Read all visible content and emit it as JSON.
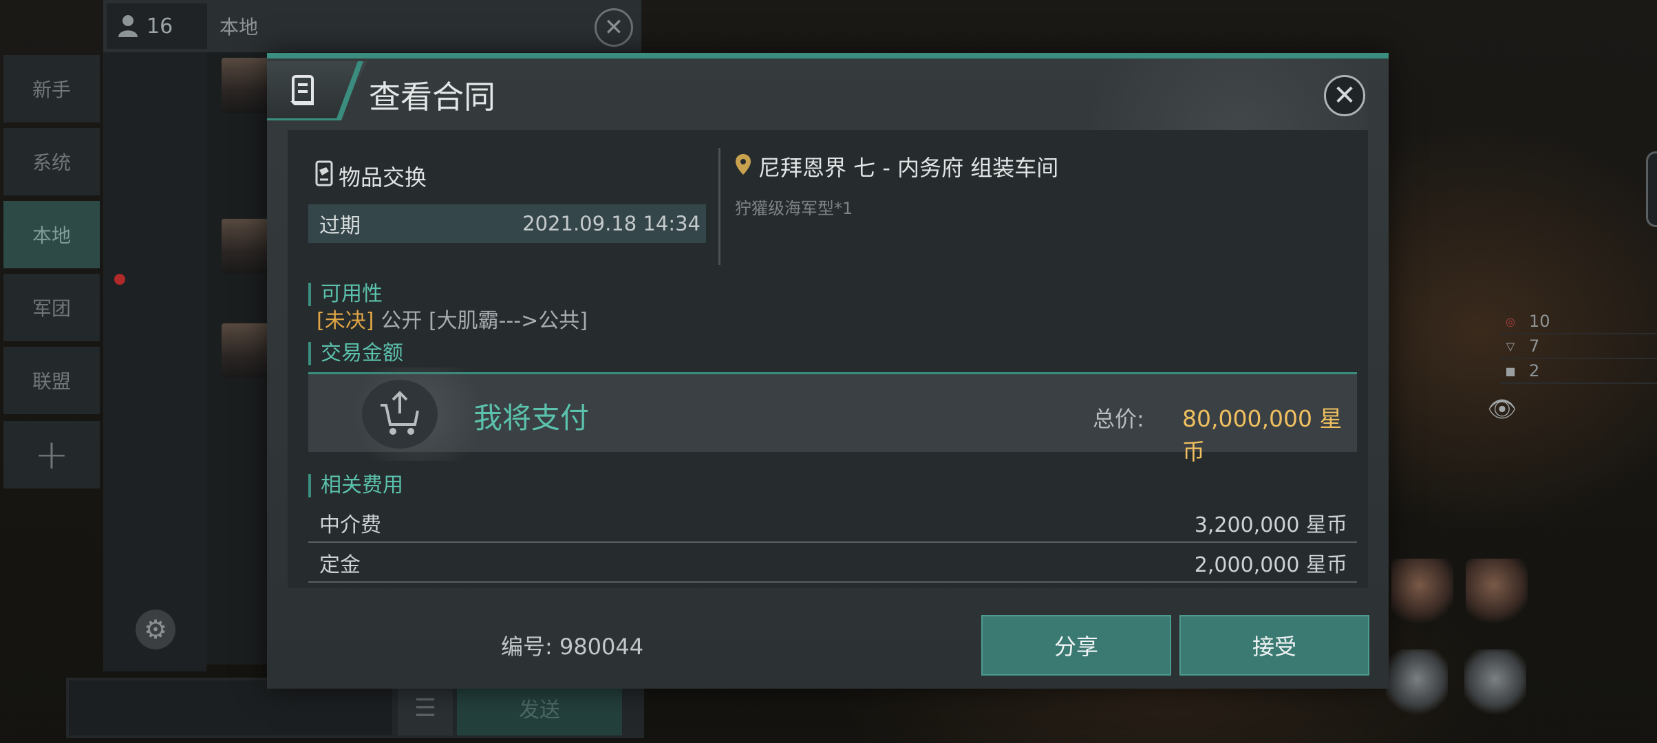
{
  "chat": {
    "online_count": "16",
    "channel_title": "本地",
    "tabs": [
      "新手",
      "系统",
      "本地",
      "军团",
      "联盟"
    ],
    "active_tab": "本地",
    "input_placeholder": "",
    "send_label": "发送"
  },
  "hud": {
    "stats": [
      {
        "icon": "target-icon",
        "value": "10"
      },
      {
        "icon": "shield-icon",
        "value": "7"
      },
      {
        "icon": "square-icon",
        "value": "2"
      }
    ]
  },
  "dialog": {
    "title": "查看合同",
    "contract_type": "物品交换",
    "expire_label": "过期",
    "expire_date": "2021.09.18 14:34",
    "location": "尼拜恩界 七 - 内务府 组装车间",
    "item": "狞獾级海军型*1",
    "availability_label": "可用性",
    "availability_status": "[未决]",
    "availability_text": "公开 [大肌霸--->公共]",
    "amount_label": "交易金额",
    "pay_label": "我将支付",
    "total_label": "总价:",
    "total_value": "80,000,000 星币",
    "fees_label": "相关费用",
    "fees": [
      {
        "name": "中介费",
        "value": "3,200,000 星币"
      },
      {
        "name": "定金",
        "value": "2,000,000 星币"
      }
    ],
    "serial": "编号: 980044",
    "share_label": "分享",
    "accept_label": "接受"
  },
  "colors": {
    "accent": "#3b8e7f",
    "accent_text": "#5bc2ad",
    "price": "#f0c060",
    "pending": "#e0a544"
  }
}
